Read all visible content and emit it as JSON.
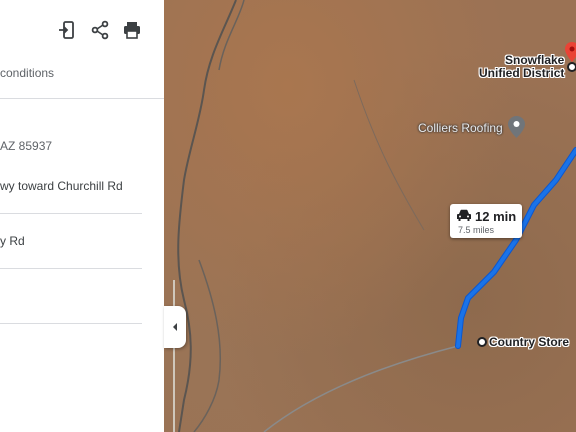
{
  "panel": {
    "conditions_text": "conditions",
    "address_text": "AZ 85937",
    "step1_text": "wy toward Churchill Rd",
    "step2_text": "y Rd",
    "toolbar_icons": [
      "send-to-phone-icon",
      "share-icon",
      "print-icon"
    ]
  },
  "map": {
    "destination_label_line1": "Snowflake",
    "destination_label_line2": "Unified District",
    "poi_label": "Colliers Roofing",
    "origin_label": "Country Store",
    "route_time": "12 min",
    "route_distance": "7.5 miles",
    "route_color": "#1a73e8"
  }
}
